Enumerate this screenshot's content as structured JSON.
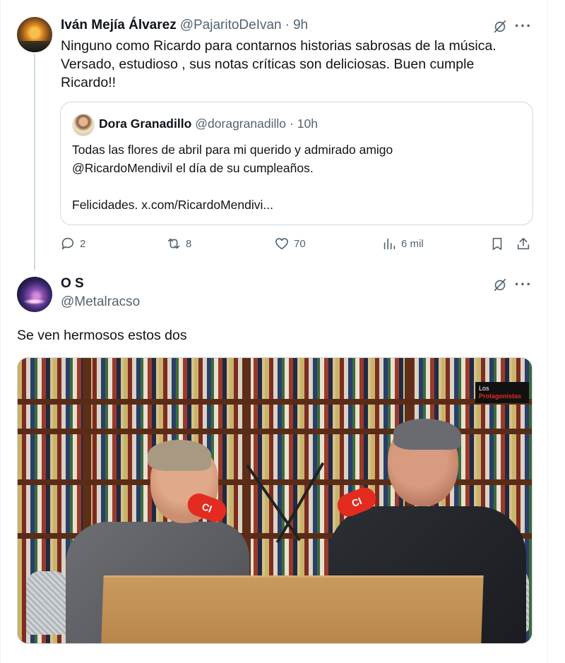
{
  "tweet1": {
    "author_name": "Iván Mejía Álvarez",
    "handle": "@PajaritoDeIvan",
    "separator": "·",
    "time": "9h",
    "text_lines": [
      "Ninguno como Ricardo para contarnos historias sabrosas de la música.",
      "Versado, estudioso , sus notas críticas son deliciosas. Buen cumple",
      "Ricardo!!"
    ],
    "quote": {
      "author_name": "Dora Granadillo",
      "handle": "@doragranadillo",
      "separator": "·",
      "time": "10h",
      "text_lines": [
        "Todas las flores de abril para mi querido y admirado amigo",
        "@RicardoMendivil el día de su cumpleaños.",
        "",
        "Felicidades. x.com/RicardoMendivi..."
      ]
    },
    "actions": {
      "replies": "2",
      "reposts": "8",
      "likes": "70",
      "views": "6 mil"
    }
  },
  "tweet2": {
    "author_name": "O S",
    "handle": "@Metalracso",
    "text": "Se ven hermosos estos dos",
    "media": {
      "mic_label_1": "CI",
      "mic_label_2": "CI",
      "logo_line1": "Los",
      "logo_line2": "Protagonistas"
    }
  },
  "icons": {
    "grok": "grok-icon",
    "more": "more-icon",
    "reply": "reply-icon",
    "repost": "repost-icon",
    "like": "like-icon",
    "views": "views-icon",
    "bookmark": "bookmark-icon",
    "share": "share-icon"
  },
  "colors": {
    "text_primary": "#0f1419",
    "text_secondary": "#536471",
    "border": "#cfd9de",
    "mic_red": "#e32b1f"
  },
  "more_glyph": "···"
}
